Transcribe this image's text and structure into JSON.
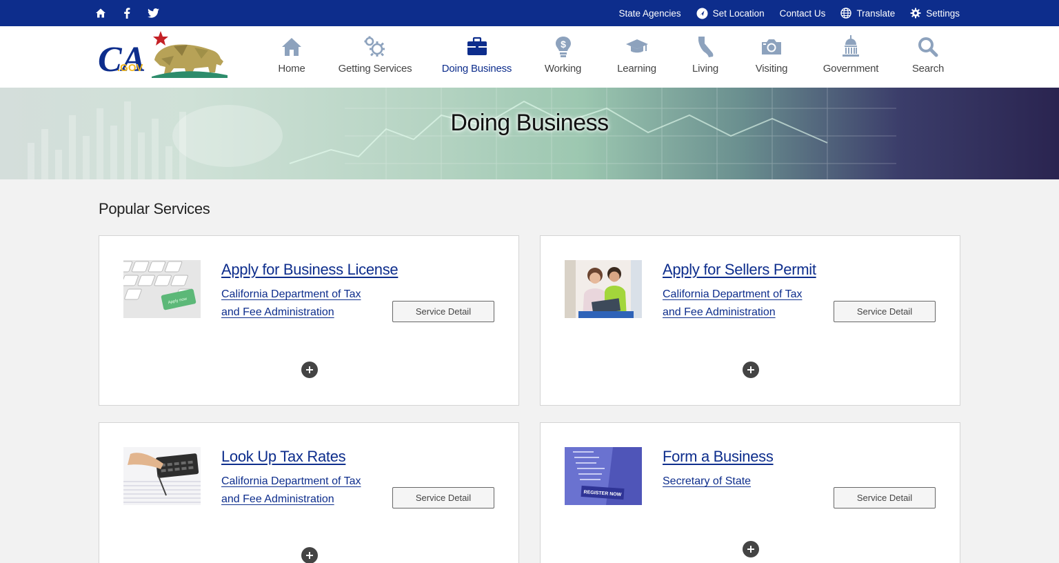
{
  "utility_bar": {
    "icons": [
      "home-icon",
      "facebook-icon",
      "twitter-icon"
    ],
    "links": [
      {
        "label": "State Agencies",
        "icon": ""
      },
      {
        "label": "Set Location",
        "icon": "location-icon"
      },
      {
        "label": "Contact Us",
        "icon": ""
      },
      {
        "label": "Translate",
        "icon": "globe-icon"
      },
      {
        "label": "Settings",
        "icon": "gear-icon"
      }
    ]
  },
  "header": {
    "logo_text": "CA.GOV",
    "nav": [
      {
        "label": "Home",
        "icon": "home-icon",
        "active": false
      },
      {
        "label": "Getting Services",
        "icon": "gears-icon",
        "active": false
      },
      {
        "label": "Doing Business",
        "icon": "briefcase-icon",
        "active": true
      },
      {
        "label": "Working",
        "icon": "lightbulb-dollar-icon",
        "active": false
      },
      {
        "label": "Learning",
        "icon": "graduation-cap-icon",
        "active": false
      },
      {
        "label": "Living",
        "icon": "california-icon",
        "active": false
      },
      {
        "label": "Visiting",
        "icon": "camera-icon",
        "active": false
      },
      {
        "label": "Government",
        "icon": "capitol-icon",
        "active": false
      },
      {
        "label": "Search",
        "icon": "search-icon",
        "active": false
      }
    ]
  },
  "hero": {
    "title": "Doing Business"
  },
  "main": {
    "section_title": "Popular Services",
    "cards": [
      {
        "title": "Apply for Business License",
        "agency": "California Department of Tax and Fee Administration",
        "button": "Service Detail",
        "thumb": "keyboard-apply-now"
      },
      {
        "title": "Apply for Sellers Permit",
        "agency": "California Department of Tax and Fee Administration",
        "button": "Service Detail",
        "thumb": "women-laptop"
      },
      {
        "title": "Look Up Tax Rates",
        "agency": "California Department of Tax and Fee Administration",
        "button": "Service Detail",
        "thumb": "calculator"
      },
      {
        "title": "Form a Business",
        "agency": "Secretary of State",
        "button": "Service Detail",
        "thumb": "register-now"
      }
    ]
  },
  "colors": {
    "brand_blue": "#0d2d8c",
    "nav_icon": "#8da2bd",
    "expand": "#444444"
  }
}
